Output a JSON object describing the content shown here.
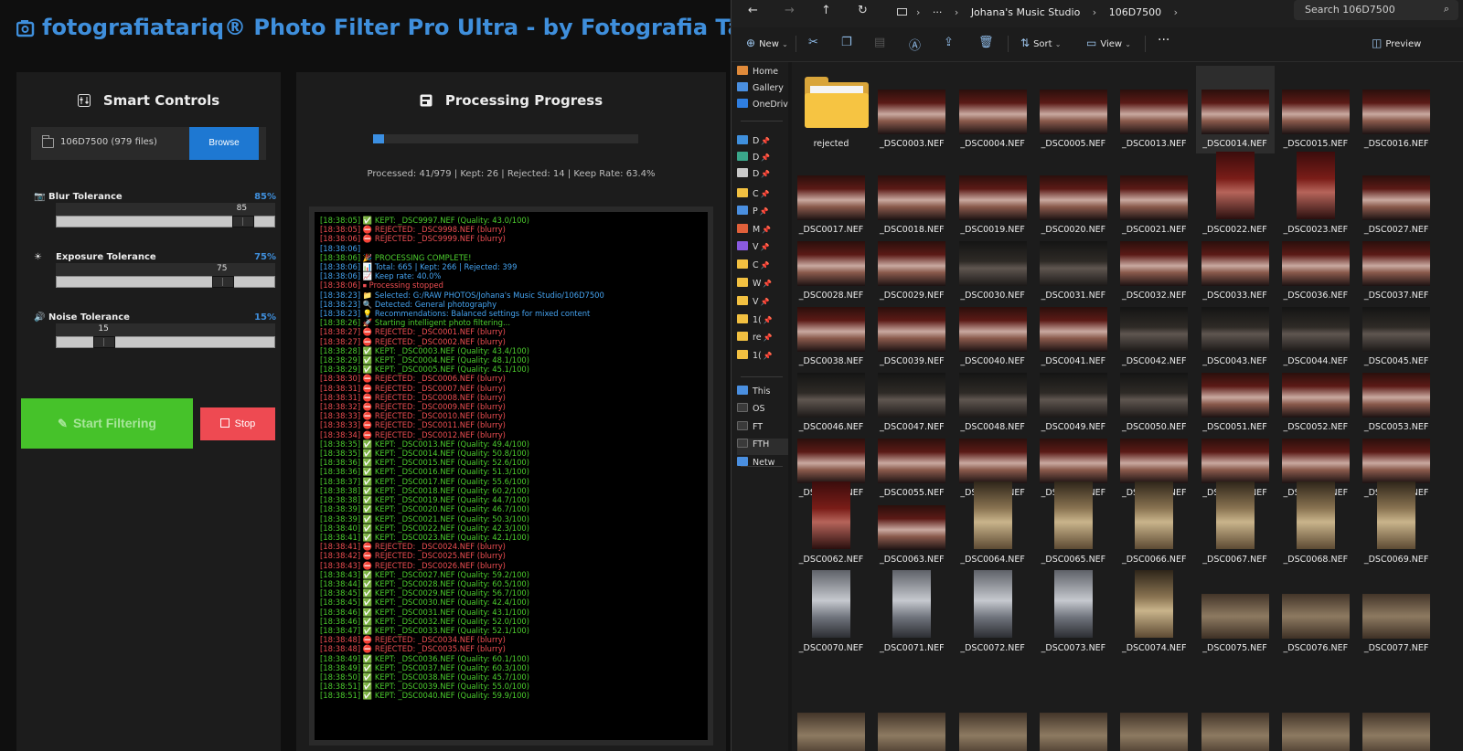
{
  "app": {
    "title": "fotografiatariq® Photo Filter Pro Ultra - by Fotografia Tariq",
    "smart_controls": {
      "heading": "Smart Controls",
      "path_label": "106D7500 (979 files)",
      "browse_label": "Browse",
      "sliders": [
        {
          "label": "Blur Tolerance",
          "value_text": "85",
          "pct_text": "85%",
          "value": 85,
          "icon": "camera-icon"
        },
        {
          "label": "Exposure Tolerance",
          "value_text": "75",
          "pct_text": "75%",
          "value": 75,
          "icon": "sun-icon"
        },
        {
          "label": "Noise Tolerance",
          "value_text": "15",
          "pct_text": "15%",
          "value": 15,
          "icon": "speaker-icon"
        }
      ],
      "start_label": "Start Filtering",
      "stop_label": "Stop"
    },
    "progress": {
      "heading": "Processing Progress",
      "fraction": 0.042,
      "stats": "Processed: 41/979 | Kept: 26 | Rejected: 14 | Keep Rate: 63.4%"
    },
    "log": [
      {
        "type": "ok",
        "text": "[18:38:05] ✅ KEPT: _DSC9997.NEF (Quality: 43.0/100)"
      },
      {
        "type": "bad",
        "text": "[18:38:05] ⛔ REJECTED: _DSC9998.NEF (blurry)"
      },
      {
        "type": "bad",
        "text": "[18:38:06] ⛔ REJECTED: _DSC9999.NEF (blurry)"
      },
      {
        "type": "info",
        "text": "[18:38:06]"
      },
      {
        "type": "ok",
        "text": "[18:38:06] 🎉 PROCESSING COMPLETE!"
      },
      {
        "type": "info",
        "text": "[18:38:06] 📊 Total: 665 | Kept: 266 | Rejected: 399"
      },
      {
        "type": "info",
        "text": "[18:38:06] 📈 Keep rate: 40.0%"
      },
      {
        "type": "bad",
        "text": "[18:38:06] ⏹ Processing stopped"
      },
      {
        "type": "info",
        "text": "[18:38:23] 📁 Selected: G:/RAW PHOTOS/Johana's Music Studio/106D7500"
      },
      {
        "type": "info",
        "text": "[18:38:23] 🔍 Detected: General photography"
      },
      {
        "type": "info",
        "text": "[18:38:23] 💡 Recommendations: Balanced settings for mixed content"
      },
      {
        "type": "ok",
        "text": "[18:38:26] 🚀 Starting intelligent photo filtering..."
      },
      {
        "type": "bad",
        "text": "[18:38:27] ⛔ REJECTED: _DSC0001.NEF (blurry)"
      },
      {
        "type": "bad",
        "text": "[18:38:27] ⛔ REJECTED: _DSC0002.NEF (blurry)"
      },
      {
        "type": "ok",
        "text": "[18:38:28] ✅ KEPT: _DSC0003.NEF (Quality: 43.4/100)"
      },
      {
        "type": "ok",
        "text": "[18:38:29] ✅ KEPT: _DSC0004.NEF (Quality: 48.1/100)"
      },
      {
        "type": "ok",
        "text": "[18:38:29] ✅ KEPT: _DSC0005.NEF (Quality: 45.1/100)"
      },
      {
        "type": "bad",
        "text": "[18:38:30] ⛔ REJECTED: _DSC0006.NEF (blurry)"
      },
      {
        "type": "bad",
        "text": "[18:38:31] ⛔ REJECTED: _DSC0007.NEF (blurry)"
      },
      {
        "type": "bad",
        "text": "[18:38:31] ⛔ REJECTED: _DSC0008.NEF (blurry)"
      },
      {
        "type": "bad",
        "text": "[18:38:32] ⛔ REJECTED: _DSC0009.NEF (blurry)"
      },
      {
        "type": "bad",
        "text": "[18:38:33] ⛔ REJECTED: _DSC0010.NEF (blurry)"
      },
      {
        "type": "bad",
        "text": "[18:38:33] ⛔ REJECTED: _DSC0011.NEF (blurry)"
      },
      {
        "type": "bad",
        "text": "[18:38:34] ⛔ REJECTED: _DSC0012.NEF (blurry)"
      },
      {
        "type": "ok",
        "text": "[18:38:35] ✅ KEPT: _DSC0013.NEF (Quality: 49.4/100)"
      },
      {
        "type": "ok",
        "text": "[18:38:35] ✅ KEPT: _DSC0014.NEF (Quality: 50.8/100)"
      },
      {
        "type": "ok",
        "text": "[18:38:36] ✅ KEPT: _DSC0015.NEF (Quality: 52.6/100)"
      },
      {
        "type": "ok",
        "text": "[18:38:36] ✅ KEPT: _DSC0016.NEF (Quality: 51.3/100)"
      },
      {
        "type": "ok",
        "text": "[18:38:37] ✅ KEPT: _DSC0017.NEF (Quality: 55.6/100)"
      },
      {
        "type": "ok",
        "text": "[18:38:38] ✅ KEPT: _DSC0018.NEF (Quality: 60.2/100)"
      },
      {
        "type": "ok",
        "text": "[18:38:38] ✅ KEPT: _DSC0019.NEF (Quality: 44.7/100)"
      },
      {
        "type": "ok",
        "text": "[18:38:39] ✅ KEPT: _DSC0020.NEF (Quality: 46.7/100)"
      },
      {
        "type": "ok",
        "text": "[18:38:39] ✅ KEPT: _DSC0021.NEF (Quality: 50.3/100)"
      },
      {
        "type": "ok",
        "text": "[18:38:40] ✅ KEPT: _DSC0022.NEF (Quality: 42.3/100)"
      },
      {
        "type": "ok",
        "text": "[18:38:41] ✅ KEPT: _DSC0023.NEF (Quality: 42.1/100)"
      },
      {
        "type": "bad",
        "text": "[18:38:41] ⛔ REJECTED: _DSC0024.NEF (blurry)"
      },
      {
        "type": "bad",
        "text": "[18:38:42] ⛔ REJECTED: _DSC0025.NEF (blurry)"
      },
      {
        "type": "bad",
        "text": "[18:38:43] ⛔ REJECTED: _DSC0026.NEF (blurry)"
      },
      {
        "type": "ok",
        "text": "[18:38:43] ✅ KEPT: _DSC0027.NEF (Quality: 59.2/100)"
      },
      {
        "type": "ok",
        "text": "[18:38:44] ✅ KEPT: _DSC0028.NEF (Quality: 60.5/100)"
      },
      {
        "type": "ok",
        "text": "[18:38:45] ✅ KEPT: _DSC0029.NEF (Quality: 56.7/100)"
      },
      {
        "type": "ok",
        "text": "[18:38:45] ✅ KEPT: _DSC0030.NEF (Quality: 42.4/100)"
      },
      {
        "type": "ok",
        "text": "[18:38:46] ✅ KEPT: _DSC0031.NEF (Quality: 43.1/100)"
      },
      {
        "type": "ok",
        "text": "[18:38:46] ✅ KEPT: _DSC0032.NEF (Quality: 52.0/100)"
      },
      {
        "type": "ok",
        "text": "[18:38:47] ✅ KEPT: _DSC0033.NEF (Quality: 52.1/100)"
      },
      {
        "type": "bad",
        "text": "[18:38:48] ⛔ REJECTED: _DSC0034.NEF (blurry)"
      },
      {
        "type": "bad",
        "text": "[18:38:48] ⛔ REJECTED: _DSC0035.NEF (blurry)"
      },
      {
        "type": "ok",
        "text": "[18:38:49] ✅ KEPT: _DSC0036.NEF (Quality: 60.1/100)"
      },
      {
        "type": "ok",
        "text": "[18:38:49] ✅ KEPT: _DSC0037.NEF (Quality: 60.3/100)"
      },
      {
        "type": "ok",
        "text": "[18:38:50] ✅ KEPT: _DSC0038.NEF (Quality: 45.7/100)"
      },
      {
        "type": "ok",
        "text": "[18:38:51] ✅ KEPT: _DSC0039.NEF (Quality: 55.0/100)"
      },
      {
        "type": "ok",
        "text": "[18:38:51] ✅ KEPT: _DSC0040.NEF (Quality: 59.9/100)"
      }
    ]
  },
  "explorer": {
    "breadcrumbs": [
      "Johana's Music Studio",
      "106D7500"
    ],
    "search_placeholder": "Search 106D7500",
    "toolbar": {
      "new": "New",
      "sort": "Sort",
      "view": "View",
      "preview": "Preview"
    },
    "nav_items": [
      {
        "label": "Home",
        "icon": "home-icon",
        "pinned": false
      },
      {
        "label": "Gallery",
        "icon": "gallery-icon",
        "pinned": false
      },
      {
        "label": "OneDrive",
        "icon": "cloud-icon",
        "pinned": false
      },
      {
        "label": "D",
        "icon": "desktop-icon",
        "pinned": true
      },
      {
        "label": "D",
        "icon": "downloads-icon",
        "pinned": true
      },
      {
        "label": "D",
        "icon": "documents-icon",
        "pinned": true
      },
      {
        "label": "C",
        "icon": "folder-icon",
        "pinned": true
      },
      {
        "label": "P",
        "icon": "pictures-icon",
        "pinned": true
      },
      {
        "label": "M",
        "icon": "music-icon",
        "pinned": true
      },
      {
        "label": "V",
        "icon": "videos-icon",
        "pinned": true
      },
      {
        "label": "C",
        "icon": "folder-icon",
        "pinned": true
      },
      {
        "label": "W",
        "icon": "folder-icon",
        "pinned": true
      },
      {
        "label": "V",
        "icon": "folder-icon",
        "pinned": true
      },
      {
        "label": "1(",
        "icon": "folder-icon",
        "pinned": true
      },
      {
        "label": "re",
        "icon": "folder-icon",
        "pinned": true
      },
      {
        "label": "1(",
        "icon": "folder-icon",
        "pinned": true
      },
      {
        "label": "This",
        "icon": "this-pc-icon",
        "pinned": false
      },
      {
        "label": "OS",
        "icon": "drive-icon",
        "pinned": false
      },
      {
        "label": "FT",
        "icon": "drive-icon",
        "pinned": false
      },
      {
        "label": "FTH",
        "icon": "drive-icon",
        "pinned": false
      },
      {
        "label": "Netw",
        "icon": "network-icon",
        "pinned": false
      }
    ],
    "files": [
      "rejected",
      "_DSC0003.NEF",
      "_DSC0004.NEF",
      "_DSC0005.NEF",
      "_DSC0013.NEF",
      "_DSC0014.NEF",
      "_DSC0015.NEF",
      "_DSC0016.NEF",
      "_DSC0017.NEF",
      "_DSC0018.NEF",
      "_DSC0019.NEF",
      "_DSC0020.NEF",
      "_DSC0021.NEF",
      "_DSC0022.NEF",
      "_DSC0023.NEF",
      "_DSC0027.NEF",
      "_DSC0028.NEF",
      "_DSC0029.NEF",
      "_DSC0030.NEF",
      "_DSC0031.NEF",
      "_DSC0032.NEF",
      "_DSC0033.NEF",
      "_DSC0036.NEF",
      "_DSC0037.NEF",
      "_DSC0038.NEF",
      "_DSC0039.NEF",
      "_DSC0040.NEF",
      "_DSC0041.NEF",
      "_DSC0042.NEF",
      "_DSC0043.NEF",
      "_DSC0044.NEF",
      "_DSC0045.NEF",
      "_DSC0046.NEF",
      "_DSC0047.NEF",
      "_DSC0048.NEF",
      "_DSC0049.NEF",
      "_DSC0050.NEF",
      "_DSC0051.NEF",
      "_DSC0052.NEF",
      "_DSC0053.NEF",
      "_DSC0054.NEF",
      "_DSC0055.NEF",
      "_DSC0056.NEF",
      "_DSC0057.NEF",
      "_DSC0058.NEF",
      "_DSC0059.NEF",
      "_DSC0060.NEF",
      "_DSC0061.NEF",
      "_DSC0062.NEF",
      "_DSC0063.NEF",
      "_DSC0064.NEF",
      "_DSC0065.NEF",
      "_DSC0066.NEF",
      "_DSC0067.NEF",
      "_DSC0068.NEF",
      "_DSC0069.NEF",
      "_DSC0070.NEF",
      "_DSC0071.NEF",
      "_DSC0072.NEF",
      "_DSC0073.NEF",
      "_DSC0074.NEF",
      "_DSC0075.NEF",
      "_DSC0076.NEF",
      "_DSC0077.NEF"
    ],
    "selected_file": "_DSC0014.NEF"
  }
}
